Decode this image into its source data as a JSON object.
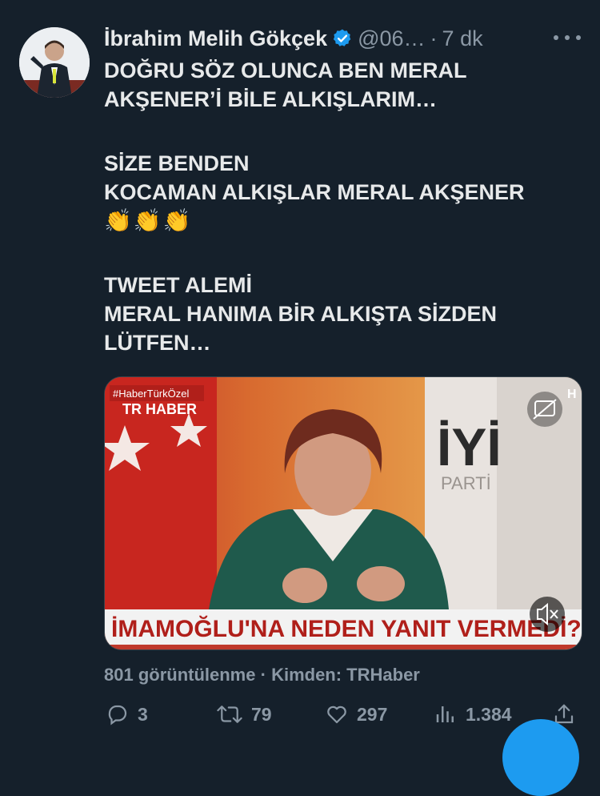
{
  "tweet": {
    "author_name": "İbrahim Melih Gökçek",
    "handle": "@06…",
    "separator": "·",
    "time": "7 dk",
    "body_lines_1": [
      "DOĞRU SÖZ OLUNCA BEN MERAL",
      "AKŞENER’İ BİLE ALKIŞLARIM…"
    ],
    "body_lines_2": [
      "SİZE BENDEN",
      "KOCAMAN ALKIŞLAR MERAL AKŞENER"
    ],
    "emojis": "👏👏👏",
    "body_lines_3": [
      "TWEET ALEMİ",
      "MERAL HANIMA BİR ALKIŞTA SİZDEN",
      "LÜTFEN…"
    ]
  },
  "video": {
    "channel_tag": "#HaberTürkÖzel",
    "channel_logo": "TR HABER",
    "banner_text": "İMAMOĞLU'NA NEDEN YANIT VERMEDİ?",
    "party_text": "İYİ",
    "party_sub": "PARTİ",
    "corner_tag": "H"
  },
  "meta": {
    "views": "801 görüntülenme",
    "sep": "·",
    "source": "Kimden: TRHaber"
  },
  "actions": {
    "replies": "3",
    "retweets": "79",
    "likes": "297",
    "views": "1.384"
  },
  "colors": {
    "background": "#15202b",
    "text": "#e7e9ea",
    "secondary": "#8b98a5",
    "accent": "#1d9bf0"
  }
}
